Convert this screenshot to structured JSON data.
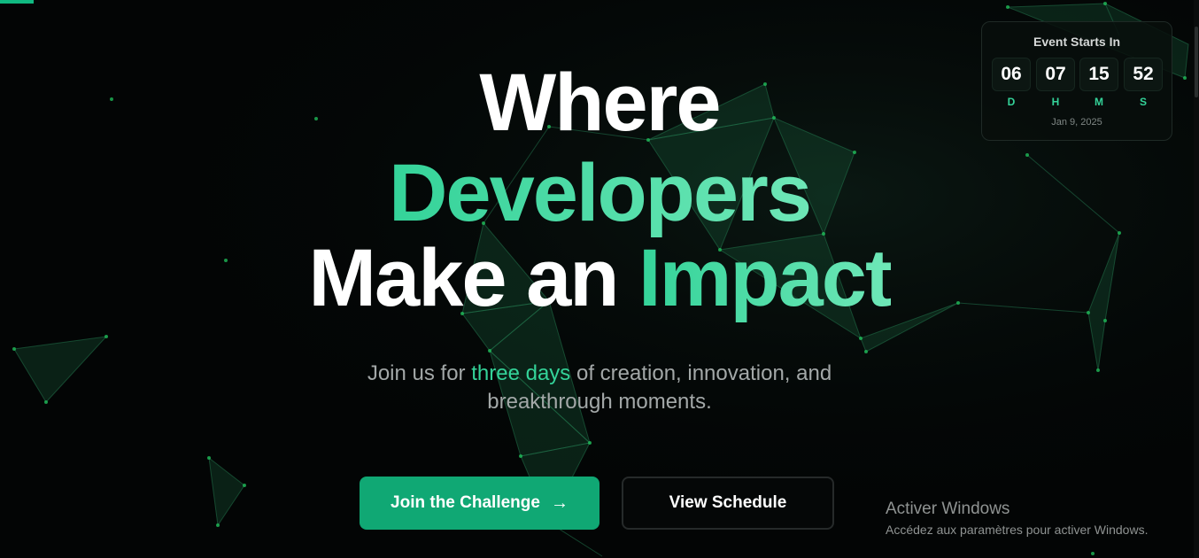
{
  "hero": {
    "line1": "Where",
    "line2": "Developers",
    "line3_white": "Make an",
    "line3_green": "Impact",
    "subtitle_before": "Join us for",
    "subtitle_highlight": "three days",
    "subtitle_after": "of creation, innovation, and breakthrough moments."
  },
  "buttons": {
    "primary_label": "Join the Challenge",
    "primary_arrow": "→",
    "secondary_label": "View Schedule"
  },
  "countdown": {
    "title": "Event Starts In",
    "days": "06",
    "hours": "07",
    "minutes": "15",
    "seconds": "52",
    "days_label": "D",
    "hours_label": "H",
    "minutes_label": "M",
    "seconds_label": "S",
    "date": "Jan 9, 2025"
  },
  "windows_watermark": {
    "title": "Activer Windows",
    "subtitle": "Accédez aux paramètres pour activer Windows."
  },
  "colors": {
    "background": "#030505",
    "accent": "#34d399",
    "button_primary": "#10a874",
    "text_muted": "#a3a8a8"
  },
  "icons": [
    "arrow-right-icon"
  ]
}
